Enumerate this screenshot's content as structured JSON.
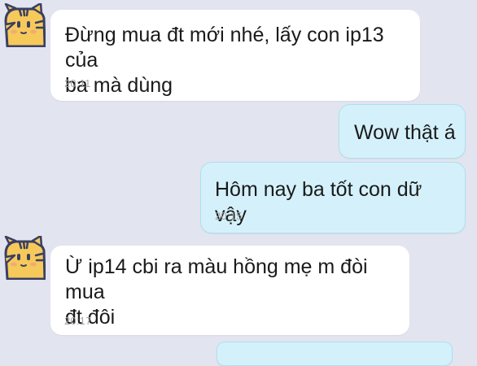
{
  "messages": [
    {
      "id": "m1",
      "direction": "incoming",
      "text": "Đừng mua đt mới nhé, lấy con ip13 của\nba mà dùng",
      "time": "20:11",
      "avatar_icon": "tiger-avatar-icon"
    },
    {
      "id": "m2",
      "direction": "outgoing",
      "text": "Wow thật á"
    },
    {
      "id": "m3",
      "direction": "outgoing",
      "text": "Hôm nay ba tốt con dữ vậy",
      "time": "20:15"
    },
    {
      "id": "m4",
      "direction": "incoming",
      "text": "Ừ ip14 cbi ra màu hồng mẹ m đòi mua\nđt đôi",
      "time": "20:17",
      "avatar_icon": "tiger-avatar-icon"
    }
  ],
  "colors": {
    "background": "#e2e4ef",
    "incoming_bubble": "#ffffff",
    "outgoing_bubble": "#d4f1fb",
    "outgoing_border": "#aee0ef",
    "timestamp": "#a7a7a7",
    "avatar_face": "#f6c95b"
  }
}
